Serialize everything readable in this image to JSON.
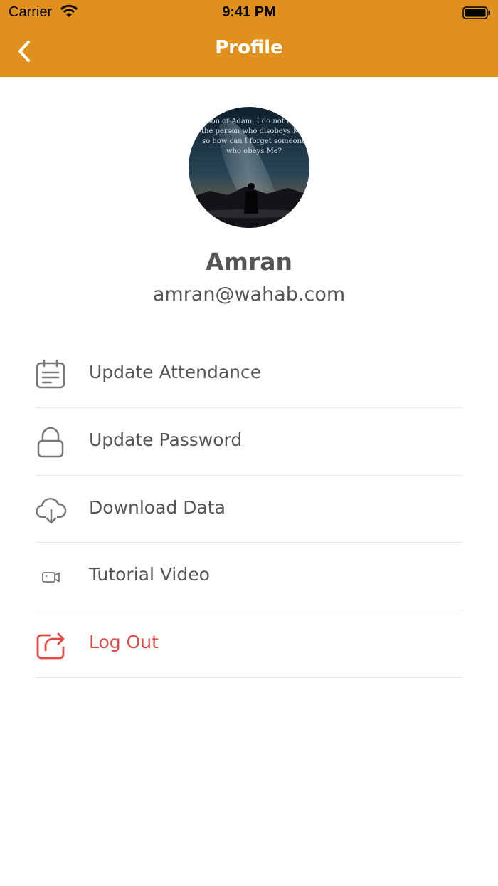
{
  "status_bar": {
    "carrier": "Carrier",
    "time": "9:41 PM",
    "wifi_icon": "wifi-icon",
    "battery_icon": "battery-icon"
  },
  "header": {
    "title": "Profile",
    "back_icon": "chevron-left-icon",
    "background_color": "#e0901c"
  },
  "profile": {
    "avatar_quote": "O son of Adam, I do not forget\nthe person who disobeys Me,\nso how can I forget someone\nwho obeys Me?",
    "name": "Amran",
    "email": "amran@wahab.com"
  },
  "menu": {
    "items": [
      {
        "label": "Update Attendance",
        "icon": "calendar-icon"
      },
      {
        "label": "Update Password",
        "icon": "lock-icon"
      },
      {
        "label": "Download Data",
        "icon": "cloud-download-icon"
      },
      {
        "label": "Tutorial Video",
        "icon": "video-camera-icon"
      },
      {
        "label": "Log Out",
        "icon": "logout-icon",
        "color": "#e14a44"
      }
    ]
  }
}
